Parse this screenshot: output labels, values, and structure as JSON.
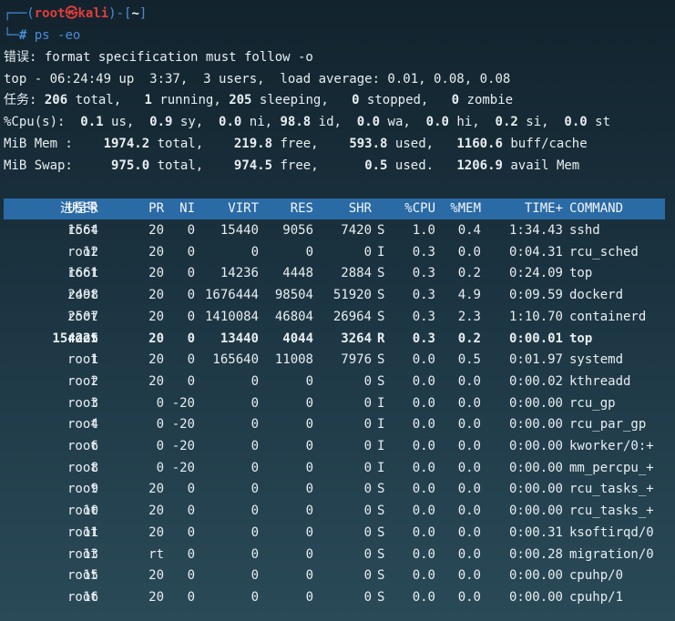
{
  "prompt": {
    "line1_prefix": "┌──(",
    "user": "root",
    "sep": "㉿",
    "host": "kali",
    "mid": ")-[",
    "dir": "~",
    "end": "]",
    "line2_prefix": "└─",
    "hash": "#",
    "command": " ps -eo"
  },
  "error": "错误: format specification must follow -o",
  "top": {
    "uptime_line": "top - 06:24:49 up  3:37,  3 users,  load average: 0.01, 0.08, 0.08",
    "tasks": {
      "label": "任务: ",
      "total": "206",
      "total_label": " total,   ",
      "running": "1",
      "running_label": " running, ",
      "sleeping": "205",
      "sleeping_label": " sleeping,   ",
      "stopped": "0",
      "stopped_label": " stopped,   ",
      "zombie": "0",
      "zombie_label": " zombie"
    },
    "cpu": {
      "label": "%Cpu(s):  ",
      "us": "0.1",
      "us_l": " us,  ",
      "sy": "0.9",
      "sy_l": " sy,  ",
      "ni": "0.0",
      "ni_l": " ni, ",
      "id": "98.8",
      "id_l": " id,  ",
      "wa": "0.0",
      "wa_l": " wa,  ",
      "hi": "0.0",
      "hi_l": " hi,  ",
      "si": "0.2",
      "si_l": " si,  ",
      "st": "0.0",
      "st_l": " st"
    },
    "mem": {
      "label": "MiB Mem :    ",
      "total": "1974.2",
      "total_l": " total,    ",
      "free": "219.8",
      "free_l": " free,    ",
      "used": "593.8",
      "used_l": " used,   ",
      "cache": "1160.6",
      "cache_l": " buff/cache"
    },
    "swap": {
      "label": "MiB Swap:     ",
      "total": "975.0",
      "total_l": " total,    ",
      "free": "974.5",
      "free_l": " free,      ",
      "used": "0.5",
      "used_l": " used.   ",
      "avail": "1206.9",
      "avail_l": " avail Mem"
    }
  },
  "table": {
    "headers": [
      "进程号",
      "USER",
      "PR",
      "NI",
      "VIRT",
      "RES",
      "SHR",
      "",
      "%CPU",
      "%MEM",
      "TIME+",
      "COMMAND"
    ],
    "rows": [
      [
        "1564",
        "root",
        "20",
        "0",
        "15440",
        "9056",
        "7420",
        "S",
        "1.0",
        "0.4",
        "1:34.43",
        "sshd"
      ],
      [
        "12",
        "root",
        "20",
        "0",
        "0",
        "0",
        "0",
        "I",
        "0.3",
        "0.0",
        "0:04.31",
        "rcu_sched"
      ],
      [
        "1661",
        "root",
        "20",
        "0",
        "14236",
        "4448",
        "2884",
        "S",
        "0.3",
        "0.2",
        "0:24.09",
        "top"
      ],
      [
        "2498",
        "root",
        "20",
        "0",
        "1676444",
        "98504",
        "51920",
        "S",
        "0.3",
        "4.9",
        "0:09.59",
        "dockerd"
      ],
      [
        "2507",
        "root",
        "20",
        "0",
        "1410084",
        "46804",
        "26964",
        "S",
        "0.3",
        "2.3",
        "1:10.70",
        "containerd"
      ],
      [
        "154225",
        "root",
        "20",
        "0",
        "13440",
        "4044",
        "3264",
        "R",
        "0.3",
        "0.2",
        "0:00.01",
        "top"
      ],
      [
        "1",
        "root",
        "20",
        "0",
        "165640",
        "11008",
        "7976",
        "S",
        "0.0",
        "0.5",
        "0:01.97",
        "systemd"
      ],
      [
        "2",
        "root",
        "20",
        "0",
        "0",
        "0",
        "0",
        "S",
        "0.0",
        "0.0",
        "0:00.02",
        "kthreadd"
      ],
      [
        "3",
        "root",
        "0",
        "-20",
        "0",
        "0",
        "0",
        "I",
        "0.0",
        "0.0",
        "0:00.00",
        "rcu_gp"
      ],
      [
        "4",
        "root",
        "0",
        "-20",
        "0",
        "0",
        "0",
        "I",
        "0.0",
        "0.0",
        "0:00.00",
        "rcu_par_gp"
      ],
      [
        "6",
        "root",
        "0",
        "-20",
        "0",
        "0",
        "0",
        "I",
        "0.0",
        "0.0",
        "0:00.00",
        "kworker/0:+"
      ],
      [
        "8",
        "root",
        "0",
        "-20",
        "0",
        "0",
        "0",
        "I",
        "0.0",
        "0.0",
        "0:00.00",
        "mm_percpu_+"
      ],
      [
        "9",
        "root",
        "20",
        "0",
        "0",
        "0",
        "0",
        "S",
        "0.0",
        "0.0",
        "0:00.00",
        "rcu_tasks_+"
      ],
      [
        "10",
        "root",
        "20",
        "0",
        "0",
        "0",
        "0",
        "S",
        "0.0",
        "0.0",
        "0:00.00",
        "rcu_tasks_+"
      ],
      [
        "11",
        "root",
        "20",
        "0",
        "0",
        "0",
        "0",
        "S",
        "0.0",
        "0.0",
        "0:00.31",
        "ksoftirqd/0"
      ],
      [
        "13",
        "root",
        "rt",
        "0",
        "0",
        "0",
        "0",
        "S",
        "0.0",
        "0.0",
        "0:00.28",
        "migration/0"
      ],
      [
        "15",
        "root",
        "20",
        "0",
        "0",
        "0",
        "0",
        "S",
        "0.0",
        "0.0",
        "0:00.00",
        "cpuhp/0"
      ],
      [
        "16",
        "root",
        "20",
        "0",
        "0",
        "0",
        "0",
        "S",
        "0.0",
        "0.0",
        "0:00.00",
        "cpuhp/1"
      ]
    ],
    "bold_row": 5
  }
}
